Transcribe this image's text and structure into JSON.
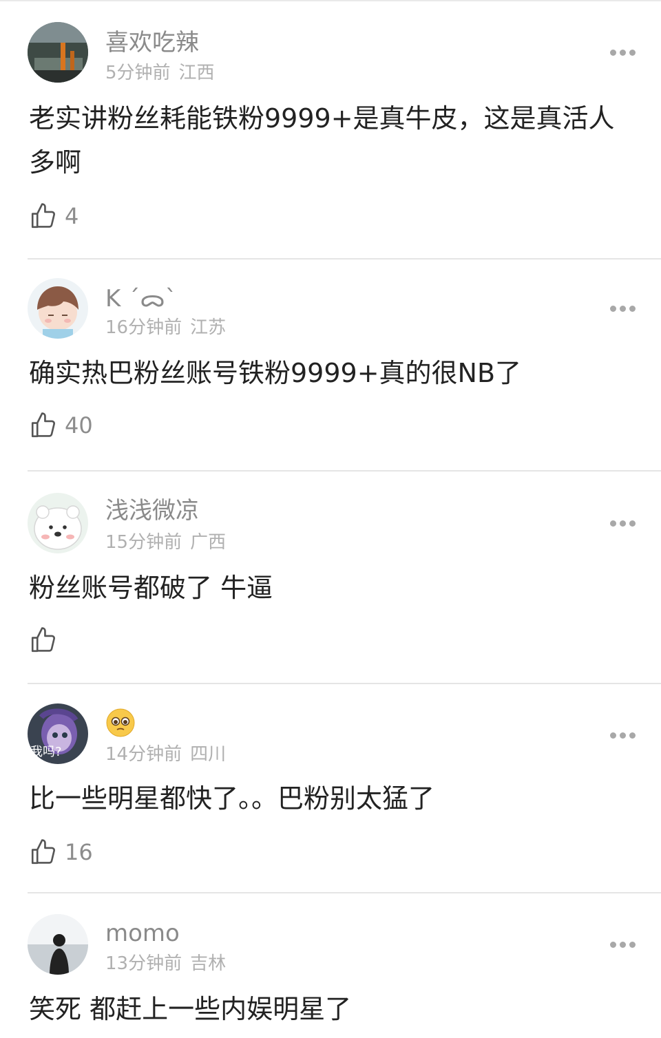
{
  "comments": [
    {
      "user": "喜欢吃辣",
      "time": "5分钟前",
      "location": "江西",
      "text": "老实讲粉丝耗能铁粉9999+是真牛皮，这是真活人多啊",
      "likes": "4"
    },
    {
      "user": "K ´ᯅ`",
      "time": "16分钟前",
      "location": "江苏",
      "text": "确实热巴粉丝账号铁粉9999+真的很NB了",
      "likes": "40"
    },
    {
      "user": "浅浅微凉",
      "time": "15分钟前",
      "location": "广西",
      "text": "粉丝账号都破了 牛逼",
      "likes": ""
    },
    {
      "user": "🥺",
      "time": "14分钟前",
      "location": "四川",
      "avatar_text": "我吗?",
      "text": "比一些明星都快了。。巴粉别太猛了",
      "likes": "16"
    },
    {
      "user": "momo",
      "time": "13分钟前",
      "location": "吉林",
      "text": "笑死 都赶上一些内娱明星了",
      "likes": ""
    }
  ],
  "icons": {
    "like": "thumbs-up-icon",
    "more": "more-dots-icon",
    "pleading_emoji": "pleading-face-emoji"
  }
}
